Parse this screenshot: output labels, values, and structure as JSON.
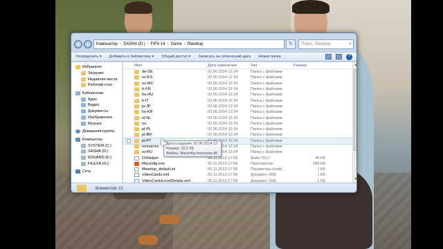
{
  "address": {
    "segments": [
      "Компьютер",
      "SASHA (D:)",
      "FIFA 14",
      "Game",
      "fifasetup"
    ],
    "search_placeholder": "Поиск: fifasetup"
  },
  "toolbar": {
    "items": [
      "Упорядочить ▾",
      "Добавить в библиотеку ▾",
      "Общий доступ ▾",
      "Записать на оптический диск",
      "Новая папка"
    ]
  },
  "nav": {
    "items": [
      {
        "label": "Избранное",
        "level": 0,
        "icon": "star-icon"
      },
      {
        "label": "Загрузки",
        "level": 1,
        "icon": "folder-icon"
      },
      {
        "label": "Недавние места",
        "level": 1,
        "icon": "folder-icon"
      },
      {
        "label": "Рабочий стол",
        "level": 1,
        "icon": "folder-icon"
      },
      {
        "label": "Библиотеки",
        "level": 0,
        "icon": "library-icon"
      },
      {
        "label": "Apps",
        "level": 1,
        "icon": "library-icon"
      },
      {
        "label": "Видео",
        "level": 1,
        "icon": "library-icon"
      },
      {
        "label": "Документы",
        "level": 1,
        "icon": "library-icon"
      },
      {
        "label": "Изображения",
        "level": 1,
        "icon": "library-icon"
      },
      {
        "label": "Музыка",
        "level": 1,
        "icon": "library-icon"
      },
      {
        "label": "Домашняя группа",
        "level": 0,
        "icon": "homegroup-icon"
      },
      {
        "label": "Компьютер",
        "level": 0,
        "icon": "computer-icon"
      },
      {
        "label": "SYSTEM (C:)",
        "level": 1,
        "icon": "drive-icon"
      },
      {
        "label": "SASHA (D:)",
        "level": 1,
        "icon": "drive-icon"
      },
      {
        "label": "EDUARD (E:)",
        "level": 1,
        "icon": "drive-icon"
      },
      {
        "label": "FILEXA (G:)",
        "level": 1,
        "icon": "drive-icon"
      },
      {
        "label": "Сеть",
        "level": 0,
        "icon": "network-icon"
      }
    ]
  },
  "columns": {
    "name": "Имя",
    "date": "Дата изменения",
    "type": "Тип",
    "size": "Размер"
  },
  "files": [
    {
      "name": "de-DE",
      "date": "02.06.2014 12:24",
      "type": "Папка с файлами",
      "size": "",
      "kind": "folder"
    },
    {
      "name": "es-ES",
      "date": "02.06.2014 12:24",
      "type": "Папка с файлами",
      "size": "",
      "kind": "folder"
    },
    {
      "name": "es-MX",
      "date": "02.06.2014 12:24",
      "type": "Папка с файлами",
      "size": "",
      "kind": "folder"
    },
    {
      "name": "fr-FR",
      "date": "02.06.2014 12:24",
      "type": "Папка с файлами",
      "size": "",
      "kind": "folder"
    },
    {
      "name": "hu-HU",
      "date": "02.06.2014 12:24",
      "type": "Папка с файлами",
      "size": "",
      "kind": "folder"
    },
    {
      "name": "it-IT",
      "date": "02.06.2014 12:24",
      "type": "Папка с файлами",
      "size": "",
      "kind": "folder"
    },
    {
      "name": "ja-JP",
      "date": "02.06.2014 12:24",
      "type": "Папка с файлами",
      "size": "",
      "kind": "folder"
    },
    {
      "name": "ko-KR",
      "date": "02.06.2014 12:24",
      "type": "Папка с файлами",
      "size": "",
      "kind": "folder"
    },
    {
      "name": "nl-NL",
      "date": "02.06.2014 12:24",
      "type": "Папка с файлами",
      "size": "",
      "kind": "folder"
    },
    {
      "name": "no",
      "date": "02.06.2014 12:24",
      "type": "Папка с файлами",
      "size": "",
      "kind": "folder"
    },
    {
      "name": "pl-PL",
      "date": "02.06.2014 12:24",
      "type": "Папка с файлами",
      "size": "",
      "kind": "folder"
    },
    {
      "name": "pt-BR",
      "date": "02.06.2014 12:24",
      "type": "Папка с файлами",
      "size": "",
      "kind": "folder"
    },
    {
      "name": "pt-PT",
      "date": "02.06.2014 12:24",
      "type": "Папка с файлами",
      "size": "",
      "kind": "folder",
      "hover": true
    },
    {
      "name": "resources",
      "date": "02.06.2014 12:24",
      "type": "Папка с файлами",
      "size": "",
      "kind": "folder"
    },
    {
      "name": "ru-RU",
      "date": "02.06.2014 12:24",
      "type": "Папка с файлами",
      "size": "",
      "kind": "folder"
    },
    {
      "name": "DXHelper",
      "date": "05.11.2013 17:58",
      "type": "Файл \"DLL\"",
      "size": "46 КБ",
      "kind": "file"
    },
    {
      "name": "fifaconfig.exe",
      "date": "05.11.2013 17:58",
      "type": "Приложение",
      "size": "389 КБ",
      "kind": "exe"
    },
    {
      "name": "fifasetup_default.ini",
      "date": "05.11.2013 17:58",
      "type": "Параметры конф...",
      "size": "1 КБ",
      "kind": "file"
    },
    {
      "name": "VideoCards.xml",
      "date": "05.11.2013 17:58",
      "type": "Документ XML",
      "size": "1 КБ",
      "kind": "xml"
    },
    {
      "name": "VideoCardsLevelDetails.xml",
      "date": "05.11.2013 17:58",
      "type": "Документ XML",
      "size": "1 КБ",
      "kind": "xml"
    }
  ],
  "tooltip": {
    "line1": "Дата создания: 02.06.2014 12:24",
    "line2": "Размер: 32,0 КБ",
    "line3": "Файлы: fifaconfig.resources.dll"
  },
  "status": {
    "count_text": "Элементов: 22"
  }
}
